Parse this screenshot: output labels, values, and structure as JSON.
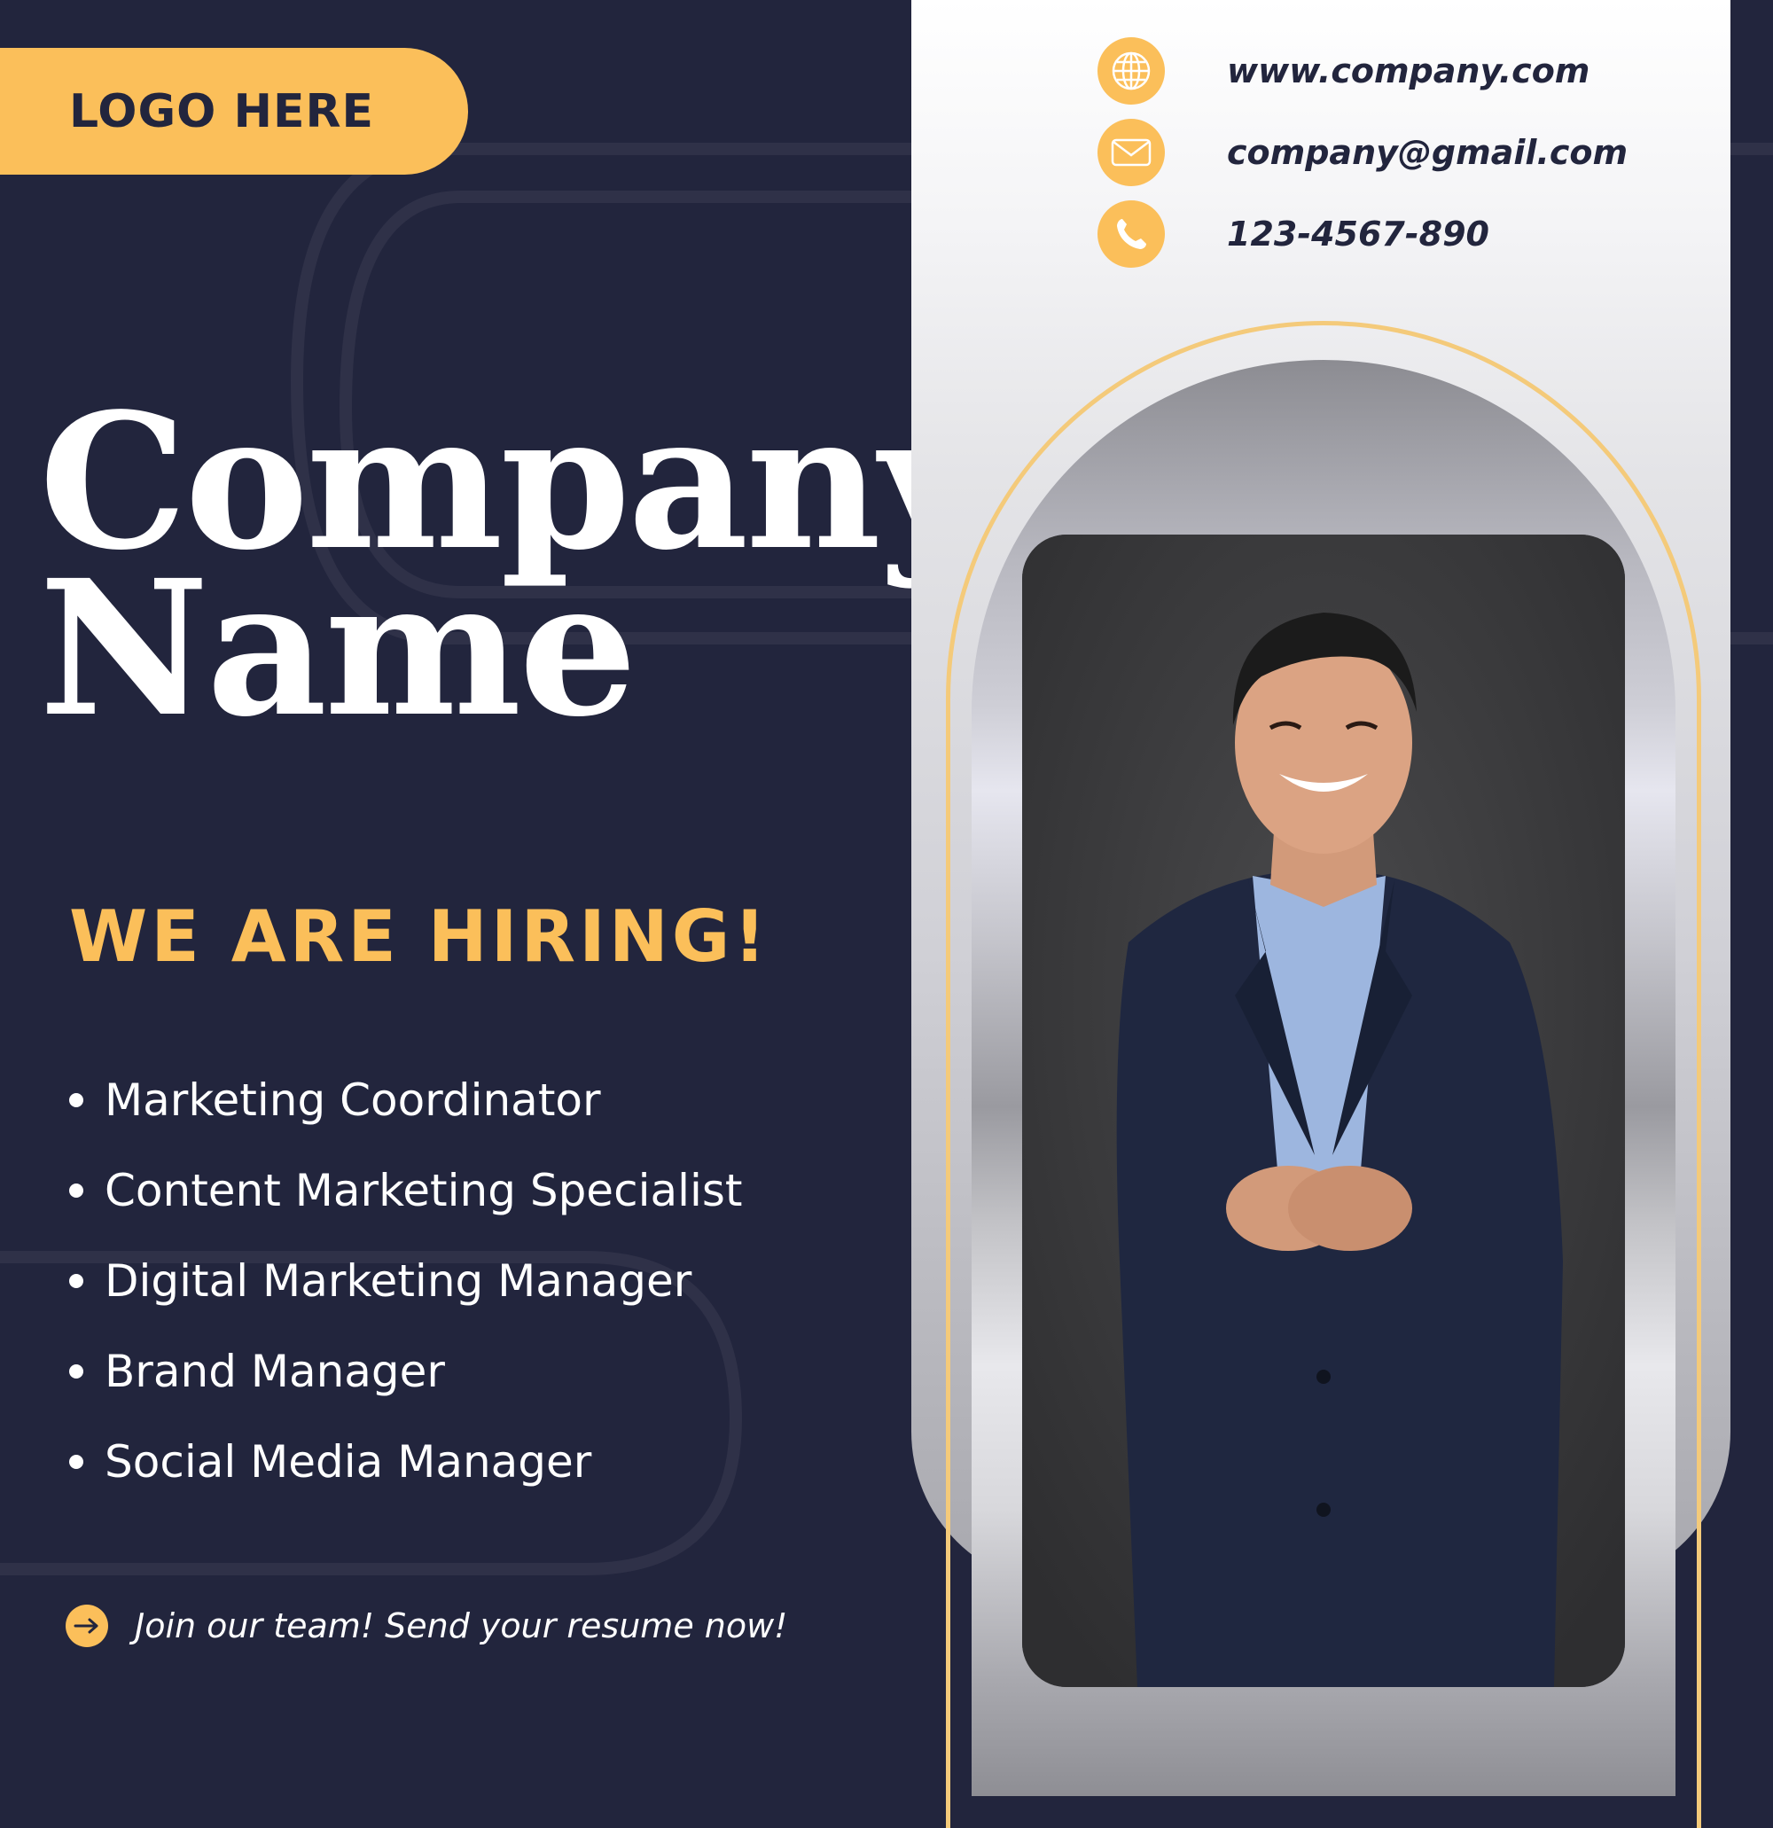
{
  "logo": {
    "text": "LOGO HERE"
  },
  "company": {
    "line1": "Company",
    "line2": "Name"
  },
  "hiring": {
    "headline": "WE ARE HIRING!"
  },
  "positions": [
    "Marketing Coordinator",
    "Content Marketing Specialist",
    "Digital Marketing Manager",
    "Brand Manager",
    "Social Media Manager"
  ],
  "cta": {
    "text": "Join our team! Send your resume now!"
  },
  "contacts": {
    "website": "www.company.com",
    "email": "company@gmail.com",
    "phone": "123-4567-890"
  },
  "icons": {
    "website": "globe-icon",
    "email": "envelope-icon",
    "phone": "phone-icon",
    "cta": "arrow-right-icon"
  },
  "colors": {
    "background": "#22253d",
    "accent": "#fbbf5a",
    "text": "#ffffff",
    "gold_outline": "#f4ca7a"
  }
}
